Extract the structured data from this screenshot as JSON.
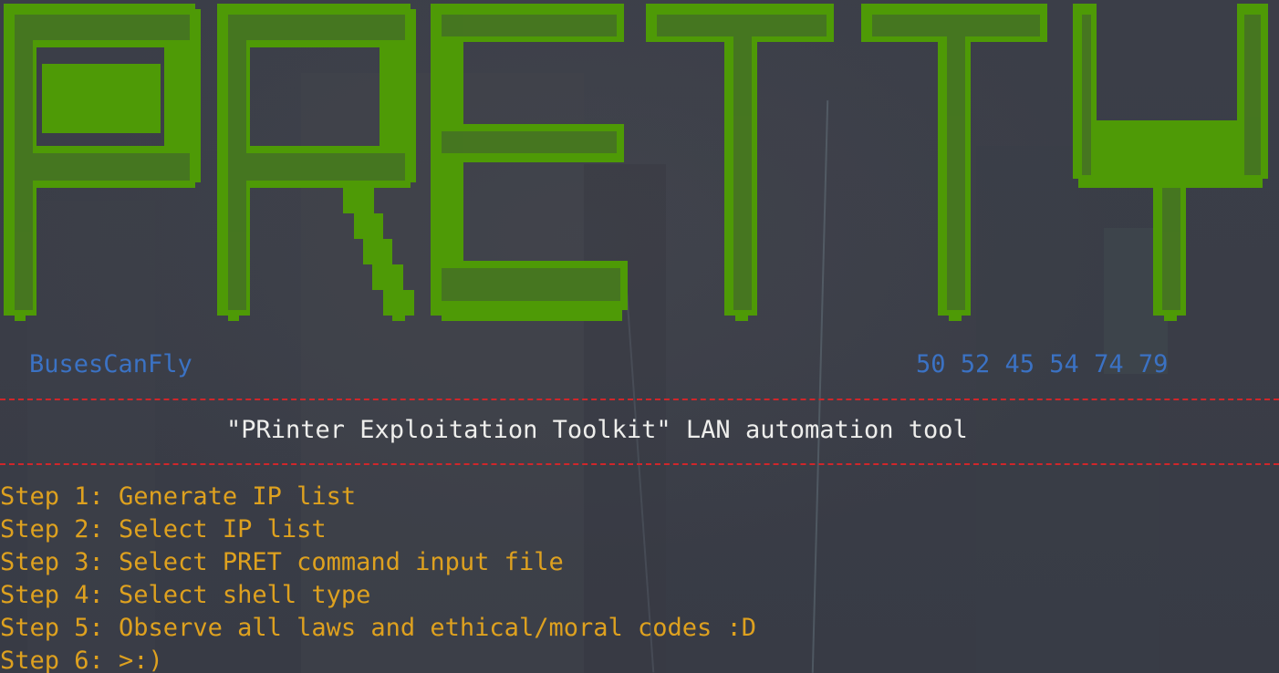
{
  "banner": {
    "text": "PRETTY",
    "fill_color": "#4e9a06",
    "shadow_color": "#3f5a36"
  },
  "tags": {
    "author": "BusesCanFly",
    "hex": "50 52 45 54 74 79"
  },
  "subtitle": "\"PRinter Exploitation Toolkit\" LAN automation tool",
  "steps": [
    "Step 1: Generate IP list",
    "Step 2: Select IP list",
    "Step 3: Select PRET command input file",
    "Step 4: Select shell type",
    "Step 5: Observe all laws and ethical/moral codes :D",
    "Step 6: >:)"
  ],
  "colors": {
    "background": "#393c46",
    "tag_blue": "#3b72c4",
    "divider_red": "#d0262a",
    "subtitle_white": "#eeeeec",
    "step_yellow": "#dea11f"
  }
}
